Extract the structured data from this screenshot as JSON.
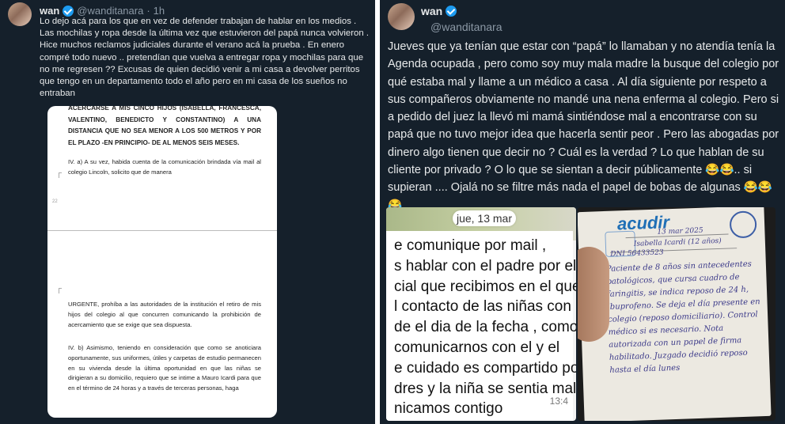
{
  "left_tweet": {
    "name": "wan",
    "handle": "@wanditanara",
    "separator": "·",
    "time": "1h",
    "text": "Lo dejo acá para los que en vez de defender trabajan de  hablar en los medios . Las mochilas y ropa desde la última vez que estuvieron del papá nunca volvieron .  Hice muchos reclamos judiciales durante el verano acá la prueba . En enero compré todo nuevo .. pretendían que vuelva a entregar ropa y mochilas para que no me regresen ?? Excusas de quien decidió venir a mi casa a devolver perritos que tengo en un departamento todo el año pero en mi casa de los sueños no entraban",
    "document": {
      "block_a": "ACERCARSE A MIS CINCO HIJOS (ISABELLA, FRANCESCA, VALENTINO, BENEDICTO Y CONSTANTINO) A UNA DISTANCIA QUE NO SEA MENOR A LOS 500 METROS Y POR EL PLAZO -EN PRINCIPIO- DE AL MENOS SEIS MESES.",
      "block_b": "IV. a) A su vez, habida cuenta de la comunicación brindada vía mail al colegio Lincoln, solicito que de manera",
      "page_number": "22",
      "block_c": "URGENTE, prohíba a las autoridades de la institución el retiro de mis hijos del colegio al que concurren comunicando la prohibición de acercamiento que se exige que sea dispuesta.",
      "block_d": "IV. b) Asimismo, teniendo en consideración que como se anoticiara oportunamente, sus uniformes, útiles y carpetas de estudio permanecen en su vivienda desde la última oportunidad en que las niñas se dirigieran a su domicilio, requiero que se intime a Mauro Icardi para que en el término de 24 horas y a través de terceras personas, haga"
    }
  },
  "right_tweet": {
    "name": "wan",
    "handle": "@wanditanara",
    "text": "Jueves que ya tenían que estar con “papá” lo llamaban y no atendía tenía la Agenda ocupada , pero como soy muy mala madre la busque del colegio por qué estaba mal y llame a un médico a casa . Al día siguiente por respeto a sus compañeros obviamente no mandé una nena enferma al colegio. Pero si a pedido del juez la llevó mi mamá sintiéndose mal a encontrarse con su papá que no tuvo mejor idea que hacerla sentir peor . Pero las abogadas por dinero algo tienen que decir no ? Cuál es la verdad ? Lo que hablan de su cliente por privado ? O lo que se sientan a decir públicamente 😂😂.. si supieran ....  Ojalá no se filtre más nada el papel de bobas de algunas 😂😂😂",
    "chat_screenshot": {
      "date_pill": "jue, 13 mar",
      "message": "e comunique por mail ,\ns hablar con el padre por el\ncial que recibimos en el que se\nl contacto de las niñas con el\nde el dia de la fecha , como no\ncomunicarnos con el y el\ne cuidado es compartido por\ndres y la niña se sentia mal ,\nnicamos contigo",
      "time": "13:4"
    },
    "paper_note": {
      "logo": "acudir",
      "field_date": "13 mar 2025",
      "field_name": "Isabella Icardi (12 años)",
      "field_dni": "DNI 56433523",
      "handwriting": "Paciente de 8 años sin antecedentes patológicos, que cursa cuadro de faringitis, se indica reposo de 24 h, ibuprofeno. Se deja el día presente en colegio (reposo domiciliario). Control médico si es necesario. Nota autorizada con un papel de firma habilitado. Juzgado decidió reposo hasta el día lunes"
    }
  }
}
